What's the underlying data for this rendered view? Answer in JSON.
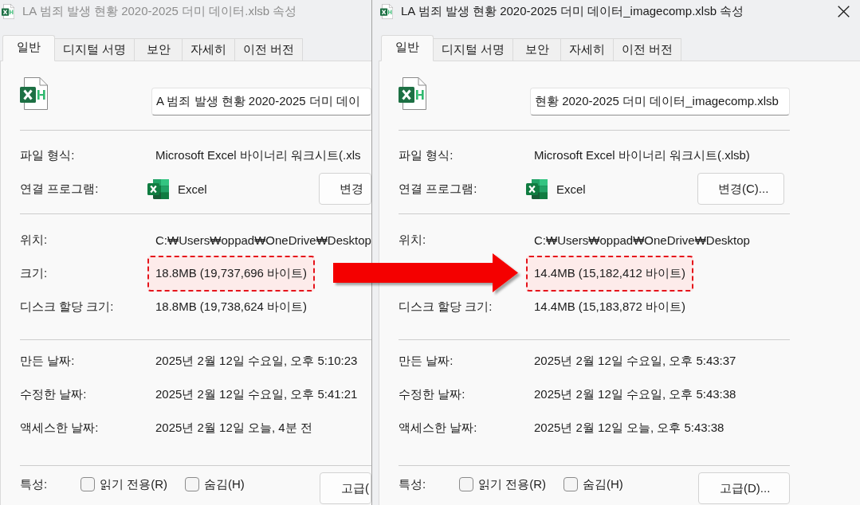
{
  "windows": [
    {
      "title": "LA 범죄 발생 현황 2020-2025 더미 데이터.xlsb 속성",
      "active": false,
      "tabs": [
        {
          "label": "일반",
          "selected": true
        },
        {
          "label": "디지털 서명",
          "selected": false
        },
        {
          "label": "보안",
          "selected": false
        },
        {
          "label": "자세히",
          "selected": false
        },
        {
          "label": "이전 버전",
          "selected": false
        }
      ],
      "file_name": "A 범죄 발생 현황 2020-2025 더미 데이",
      "sections": [
        {
          "rows": [
            {
              "kind": "text",
              "label": "파일 형식:",
              "value": "Microsoft Excel 바이너리 워크시트(.xls",
              "highlighted": false
            },
            {
              "kind": "app",
              "label": "연결 프로그램:",
              "value": "Excel",
              "button": "변경",
              "highlighted": false
            }
          ]
        },
        {
          "rows": [
            {
              "kind": "text",
              "label": "위치:",
              "value": "C:₩Users₩oppad₩OneDrive₩Desktop",
              "highlighted": false
            },
            {
              "kind": "text",
              "label": "크기:",
              "value": "18.8MB (19,737,696 바이트)",
              "highlighted": true
            },
            {
              "kind": "text",
              "label": "디스크 할당 크기:",
              "value": "18.8MB (19,738,624 바이트)",
              "highlighted": false
            }
          ]
        },
        {
          "rows": [
            {
              "kind": "text",
              "label": "만든 날짜:",
              "value": "2025년 2월 12일 수요일, 오후 5:10:23",
              "highlighted": false
            },
            {
              "kind": "text",
              "label": "수정한 날짜:",
              "value": "2025년 2월 12일 수요일, 오후 5:41:21",
              "highlighted": false
            },
            {
              "kind": "text",
              "label": "액세스한 날짜:",
              "value": "2025년 2월 12일 오늘, 4분 전",
              "highlighted": false
            }
          ]
        }
      ],
      "attributes": {
        "label": "특성:",
        "checkboxes": [
          {
            "label": "읽기 전용(R)",
            "checked": false
          },
          {
            "label": "숨김(H)",
            "checked": false
          }
        ],
        "button": "고급("
      }
    },
    {
      "title": "LA 범죄 발생 현황 2020-2025 더미 데이터_imagecomp.xlsb 속성",
      "active": true,
      "tabs": [
        {
          "label": "일반",
          "selected": true
        },
        {
          "label": "디지털 서명",
          "selected": false
        },
        {
          "label": "보안",
          "selected": false
        },
        {
          "label": "자세히",
          "selected": false
        },
        {
          "label": "이전 버전",
          "selected": false
        }
      ],
      "file_name": "현황 2020-2025 더미 데이터_imagecomp.xlsb",
      "sections": [
        {
          "rows": [
            {
              "kind": "text",
              "label": "파일 형식:",
              "value": "Microsoft Excel 바이너리 워크시트(.xlsb)",
              "highlighted": false
            },
            {
              "kind": "app",
              "label": "연결 프로그램:",
              "value": "Excel",
              "button": "변경(C)...",
              "highlighted": false
            }
          ]
        },
        {
          "rows": [
            {
              "kind": "text",
              "label": "위치:",
              "value": "C:₩Users₩oppad₩OneDrive₩Desktop",
              "highlighted": false
            },
            {
              "kind": "text",
              "value": "14.4MB (15,182,412 바이트)",
              "highlighted": true
            },
            {
              "kind": "text",
              "label": "디스크 할당 크기:",
              "value": "14.4MB (15,183,872 바이트)",
              "highlighted": false
            }
          ]
        },
        {
          "rows": [
            {
              "kind": "text",
              "label": "만든 날짜:",
              "value": "2025년 2월 12일 수요일, 오후 5:43:37",
              "highlighted": false
            },
            {
              "kind": "text",
              "label": "수정한 날짜:",
              "value": "2025년 2월 12일 수요일, 오후 5:43:38",
              "highlighted": false
            },
            {
              "kind": "text",
              "label": "액세스한 날짜:",
              "value": "2025년 2월 12일 오늘, 오후 5:43:38",
              "highlighted": false
            }
          ]
        }
      ],
      "attributes": {
        "label": "특성:",
        "checkboxes": [
          {
            "label": "읽기 전용(R)",
            "checked": false
          },
          {
            "label": "숨김(H)",
            "checked": false
          }
        ],
        "button": "고급(D)..."
      }
    }
  ]
}
